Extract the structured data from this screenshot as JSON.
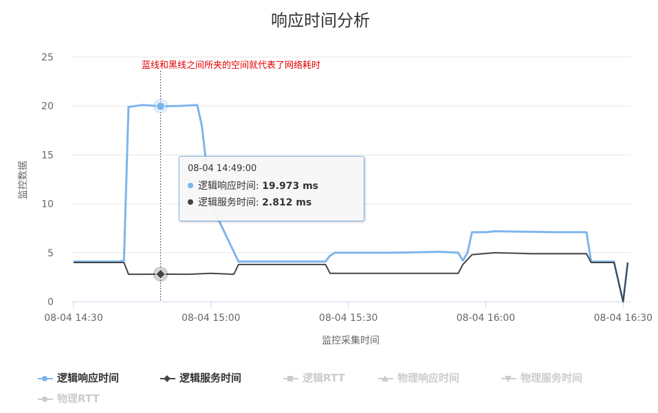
{
  "chart_data": {
    "type": "line",
    "title": "响应时间分析",
    "xlabel": "监控采集时间",
    "ylabel": "监控数据",
    "ylim": [
      0,
      25
    ],
    "yticks": [
      "0",
      "5",
      "10",
      "15",
      "20",
      "25"
    ],
    "xticks": [
      "08-04 14:30",
      "08-04 15:00",
      "08-04 15:30",
      "08-04 16:00",
      "08-04 16:30"
    ],
    "xrange": [
      "08-04 14:30",
      "08-04 16:31"
    ],
    "grid": true,
    "legend_position": "bottom",
    "annotation": "蓝线和黑线之间所夹的空间就代表了网络耗时",
    "series": [
      {
        "name": "逻辑响应时间",
        "color": "#7cb5ec",
        "visible": true,
        "marker": "circle",
        "points": [
          [
            "08-04 14:30",
            4.1
          ],
          [
            "08-04 14:40",
            4.1
          ],
          [
            "08-04 14:41",
            4.2
          ],
          [
            "08-04 14:42",
            19.9
          ],
          [
            "08-04 14:45",
            20.1
          ],
          [
            "08-04 14:49",
            19.973
          ],
          [
            "08-04 14:53",
            20.0
          ],
          [
            "08-04 14:57",
            20.1
          ],
          [
            "08-04 14:58",
            18.0
          ],
          [
            "08-04 15:00",
            10.0
          ],
          [
            "08-04 15:06",
            4.1
          ],
          [
            "08-04 15:25",
            4.1
          ],
          [
            "08-04 15:26",
            4.7
          ],
          [
            "08-04 15:27",
            5.0
          ],
          [
            "08-04 15:40",
            5.0
          ],
          [
            "08-04 15:50",
            5.1
          ],
          [
            "08-04 15:54",
            5.0
          ],
          [
            "08-04 15:55",
            4.2
          ],
          [
            "08-04 15:56",
            5.0
          ],
          [
            "08-04 15:57",
            7.1
          ],
          [
            "08-04 16:00",
            7.1
          ],
          [
            "08-04 16:02",
            7.2
          ],
          [
            "08-04 16:15",
            7.1
          ],
          [
            "08-04 16:22",
            7.1
          ],
          [
            "08-04 16:23",
            4.1
          ],
          [
            "08-04 16:28",
            4.1
          ],
          [
            "08-04 16:30",
            0.0
          ],
          [
            "08-04 16:31",
            4.0
          ]
        ]
      },
      {
        "name": "逻辑服务时间",
        "color": "#434348",
        "visible": true,
        "marker": "diamond",
        "points": [
          [
            "08-04 14:30",
            4.0
          ],
          [
            "08-04 14:41",
            4.0
          ],
          [
            "08-04 14:42",
            2.8
          ],
          [
            "08-04 14:45",
            2.8
          ],
          [
            "08-04 14:49",
            2.812
          ],
          [
            "08-04 14:55",
            2.8
          ],
          [
            "08-04 15:00",
            2.9
          ],
          [
            "08-04 15:05",
            2.8
          ],
          [
            "08-04 15:06",
            3.8
          ],
          [
            "08-04 15:25",
            3.8
          ],
          [
            "08-04 15:26",
            2.9
          ],
          [
            "08-04 15:40",
            2.9
          ],
          [
            "08-04 15:54",
            2.9
          ],
          [
            "08-04 15:55",
            3.8
          ],
          [
            "08-04 15:57",
            4.8
          ],
          [
            "08-04 16:02",
            5.0
          ],
          [
            "08-04 16:10",
            4.9
          ],
          [
            "08-04 16:22",
            4.9
          ],
          [
            "08-04 16:23",
            4.0
          ],
          [
            "08-04 16:28",
            4.0
          ],
          [
            "08-04 16:30",
            0.0
          ],
          [
            "08-04 16:31",
            4.0
          ]
        ]
      },
      {
        "name": "逻辑RTT",
        "color": "#cccccc",
        "visible": false,
        "marker": "square",
        "points": []
      },
      {
        "name": "物理响应时间",
        "color": "#cccccc",
        "visible": false,
        "marker": "triangle",
        "points": []
      },
      {
        "name": "物理服务时间",
        "color": "#cccccc",
        "visible": false,
        "marker": "triangle-down",
        "points": []
      },
      {
        "name": "物理RTT",
        "color": "#cccccc",
        "visible": false,
        "marker": "circle",
        "points": []
      }
    ]
  },
  "tooltip": {
    "time": "08-04 14:49:00",
    "rows": [
      {
        "label": "逻辑响应时间: ",
        "value": "19.973 ms",
        "color": "#7cb5ec"
      },
      {
        "label": "逻辑服务时间: ",
        "value": "2.812 ms",
        "color": "#434348"
      }
    ],
    "hover_x": "08-04 14:49"
  }
}
